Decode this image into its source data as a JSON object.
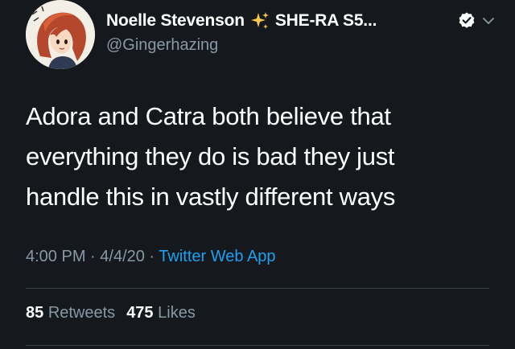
{
  "tweet": {
    "author": {
      "name_part1": "Noelle Stevenson",
      "name_part2": "SHE-RA S5...",
      "handle": "@Gingerhazing",
      "verified": true,
      "avatar_icon": "avatar-illustration-icon",
      "sparkle_icon": "sparkles-icon",
      "verified_icon": "verified-badge-icon",
      "menu_icon": "chevron-down-icon"
    },
    "text_lines": [
      "Adora and Catra both believe that",
      "everything they do is bad they just",
      "handle this in vastly different ways"
    ],
    "meta": {
      "time": "4:00 PM",
      "sep1": " · ",
      "date": "4/4/20",
      "sep2": " · ",
      "source": "Twitter Web App"
    },
    "stats": {
      "retweets_count": "85",
      "retweets_label": "Retweets",
      "likes_count": "475",
      "likes_label": "Likes"
    }
  },
  "colors": {
    "background": "#15181c",
    "primary_text": "#ffffff",
    "secondary_text": "#8899a6",
    "link": "#1da1f2",
    "divider": "#38444d"
  }
}
